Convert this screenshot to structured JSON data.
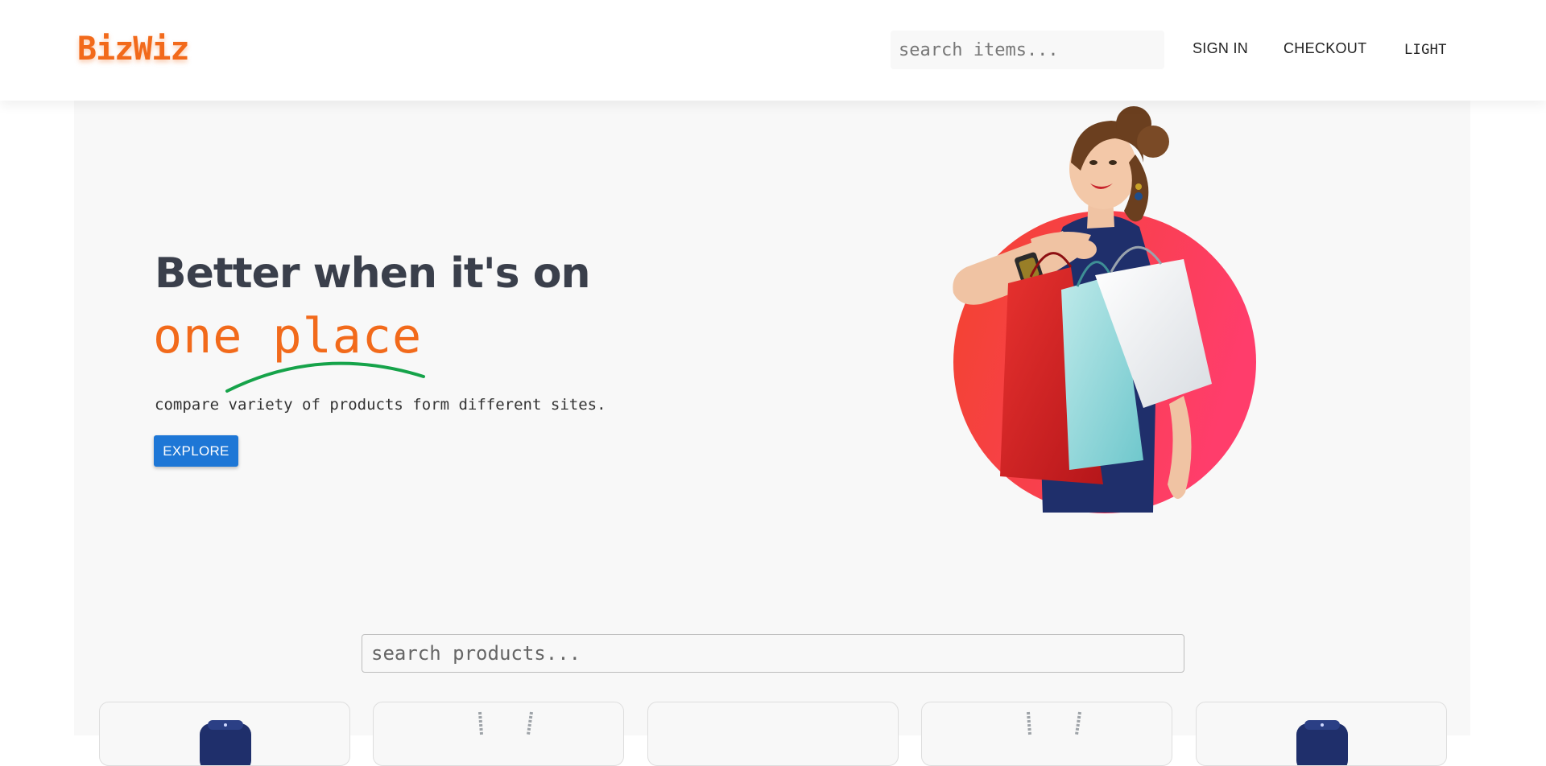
{
  "header": {
    "logo": "BizWiz",
    "search_placeholder": "search items...",
    "nav": {
      "sign_in": "SIGN IN",
      "checkout": "CHECKOUT",
      "theme_toggle": "LIGHT"
    }
  },
  "hero": {
    "headline_line1": "Better when it's on",
    "headline_line2": "one place",
    "subtext": "compare variety of products form different sites.",
    "cta_label": "EXPLORE",
    "illustration": "woman-with-shopping-bags"
  },
  "products": {
    "search_placeholder": "search products...",
    "cards": [
      {
        "thumbnail": "blue-bottle-icon"
      },
      {
        "thumbnail": "silver-necklace-icon"
      },
      {
        "thumbnail": "blank"
      },
      {
        "thumbnail": "silver-necklace-icon"
      },
      {
        "thumbnail": "blue-bottle-icon"
      }
    ]
  },
  "colors": {
    "brand_orange": "#f26a1b",
    "accent_green": "#16a34a",
    "button_blue": "#1e77d6",
    "headline_gray": "#3a3f4b",
    "circle_gradient_start": "#f2432e",
    "circle_gradient_end": "#ff3d6b"
  }
}
